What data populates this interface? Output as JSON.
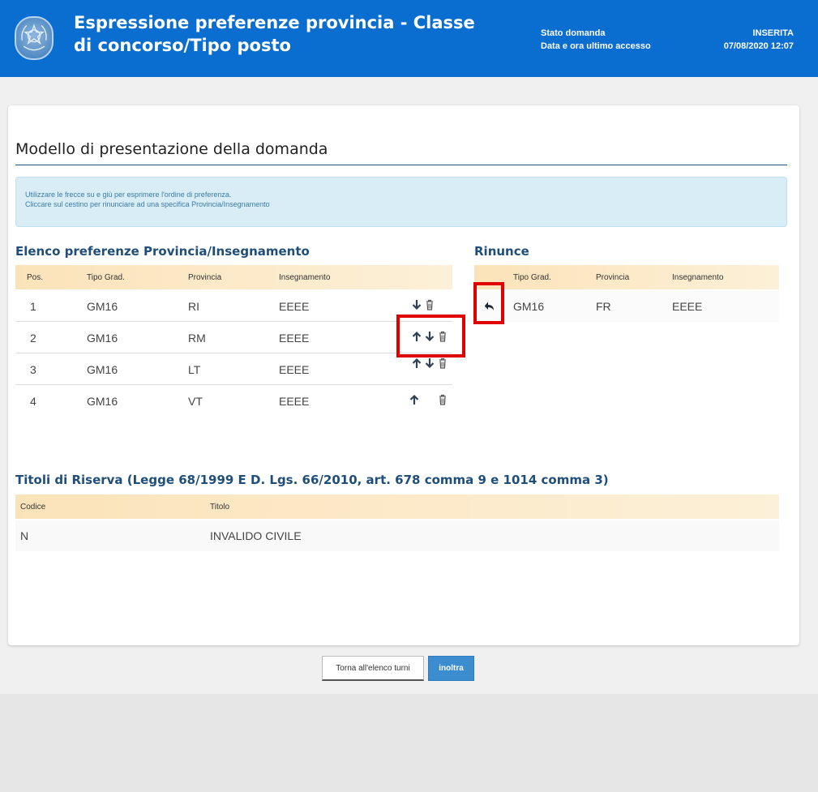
{
  "header": {
    "title": "Espressione preferenze provincia - Classe di concorso/Tipo posto",
    "status_label": "Stato domanda",
    "status_value": "INSERITA",
    "access_label": "Data e ora ultimo accesso",
    "access_value": "07/08/2020 12:07"
  },
  "main": {
    "title": "Modello di presentazione della domanda",
    "info_lines": [
      "Utilizzare le frecce su e giù per esprimere l'ordine di preferenza.",
      "Cliccare sul cestino per rinunciare ad una specifica Provincia/Insegnamento"
    ]
  },
  "preferences": {
    "title": "Elenco preferenze Provincia/Insegnamento",
    "headers": [
      "Pos.",
      "Tipo Grad.",
      "Provincia",
      "Insegnamento"
    ],
    "rows": [
      {
        "pos": "1",
        "tipo": "GM16",
        "provincia": "RI",
        "insegnamento": "EEEE",
        "actions": [
          "down-arrow-icon",
          "trash-icon"
        ]
      },
      {
        "pos": "2",
        "tipo": "GM16",
        "provincia": "RM",
        "insegnamento": "EEEE",
        "actions": [
          "up-arrow-icon",
          "down-arrow-icon",
          "trash-icon"
        ]
      },
      {
        "pos": "3",
        "tipo": "GM16",
        "provincia": "LT",
        "insegnamento": "EEEE",
        "actions": [
          "up-arrow-icon",
          "down-arrow-icon",
          "trash-icon"
        ]
      },
      {
        "pos": "4",
        "tipo": "GM16",
        "provincia": "VT",
        "insegnamento": "EEEE",
        "actions": [
          "up-arrow-icon",
          "trash-icon"
        ]
      }
    ]
  },
  "rinunce": {
    "title": "Rinunce",
    "headers": [
      "Tipo Grad.",
      "Provincia",
      "Insegnamento"
    ],
    "rows": [
      {
        "tipo": "GM16",
        "provincia": "FR",
        "insegnamento": "EEEE",
        "action": "undo-icon"
      }
    ]
  },
  "riserva": {
    "title": "Titoli di Riserva (Legge 68/1999 E D. Lgs. 66/2010, art. 678 comma 9 e 1014 comma 3)",
    "headers": [
      "Codice",
      "Titolo"
    ],
    "rows": [
      {
        "codice": "N",
        "titolo": "INVALIDO CIVILE"
      }
    ]
  },
  "footer": {
    "back_label": "Torna all'elenco turni",
    "send_label": "inoltra"
  },
  "colors": {
    "header_bg": "#0a6ed1",
    "section_title": "#1f4e79",
    "highlight": "#e00000",
    "primary_button": "#3c8dd0"
  }
}
